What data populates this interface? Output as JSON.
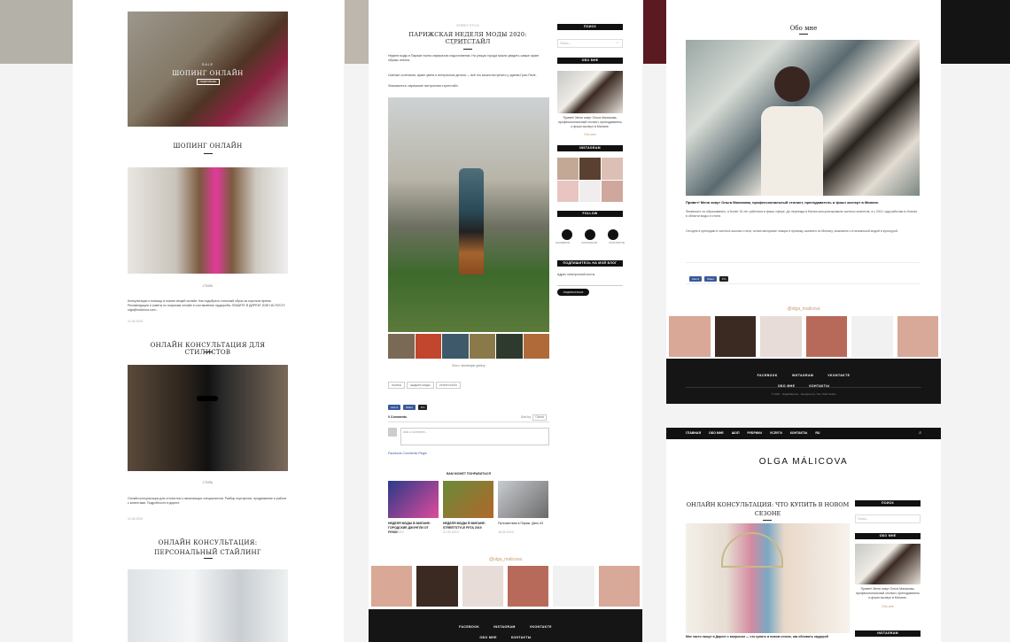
{
  "left": {
    "hero_banner": "SALE",
    "hero_title": "ШОПИНГ ОНЛАЙН",
    "hero_button": "ПОДРОБНЕЕ",
    "post1_title": "ШОПИНГ ОНЛАЙН",
    "post1_tag": "СТИЛЬ",
    "post1_excerpt": "Консультации и помощь в поиске вещей онлайн. Как подобрать стильный образ за короткое время. Рекомендации и советы по покупкам онлайн и составлению гардероба. ПИШИТЕ В ДИРЕКТ ИЛИ НА ПОЧТУ olga@malicova.com...",
    "post1_date": "11.09.2020",
    "post2_title": "ОНЛАЙН КОНСУЛЬТАЦИЯ ДЛЯ СТИЛИСТОВ",
    "post2_tag": "СТИЛЬ",
    "post2_excerpt": "Онлайн консультация для стилистов и начинающих специалистов. Разбор портфолио, продвижение и работа с клиентами. Подробности в директ.",
    "post2_date": "11.09.2020",
    "post3_title": "ОНЛАЙН КОНСУЛЬТАЦИЯ: ПЕРСОНАЛЬНЫЙ СТАЙЛИНГ"
  },
  "middle": {
    "category": "STREET STYLE",
    "title": "ПАРИЖСКАЯ НЕДЕЛЯ МОДЫ 2020: СТРИТСТАЙЛ",
    "meta": "Olga Malicova · 11.03.2020",
    "para1": "Неделя моды в Париже полна сюрпризов и вдохновения. На улицах города можно увидеть самые яркие образы сезона.",
    "para2": "Смелые сочетания, яркие цвета и интересные детали — всё это можно встретить у здания Гран-Пале.",
    "para3": "Знакомьтесь: парижские настроения стритстайл",
    "photo_credit": "Фото: streetstyle gallery",
    "tags": [
      "ПАРИЖ",
      "НЕДЕЛЯ МОДЫ",
      "СТРИТСТАЙЛ"
    ],
    "share_buttons": [
      "Like 0",
      "Share"
    ],
    "share_more": "Pin",
    "comments_count": "0 Comments",
    "sort_label": "Sort by",
    "sort_value": "Oldest",
    "comment_placeholder": "Add a comment...",
    "fb_plugin": "Facebook Comments Plugin",
    "related_heading": "ВАМ МОЖЕТ ПОНРАВИТЬСЯ",
    "related": [
      {
        "title": "НЕДЕЛЯ МОДЫ В МИЛАНЕ: ГОРОДСКИЕ ДЖУНГЛИ ОТ FENDI",
        "date": "22.09.2019"
      },
      {
        "title": "НЕДЕЛЯ МОДЫ В МИЛАНЕ: STREETSTYLE FETA 2019",
        "date": "21.09.2019"
      },
      {
        "title": "Путешествие в Париж. День #3",
        "date": "18.09.2019"
      }
    ],
    "insta_label": "@olga_malicova",
    "footer_links": [
      "FACEBOOK",
      "INSTAGRAM",
      "VKONTAKTE"
    ],
    "footer_links2": [
      "ОБО МНЕ",
      "КОНТАКТЫ"
    ],
    "sidebar": {
      "search_title": "ПОИСК",
      "search_placeholder": "Поиск...",
      "about_title": "ОБО МНЕ",
      "about_text": "Привет! Меня зовут Ольга Маликова, профессиональный стилист, преподаватель и фэшн эксперт в Милане.",
      "about_link": "Обо мне",
      "insta_title": "INSTAGRAM",
      "follow_title": "FOLLOW",
      "social": [
        "FACEBOOK",
        "INSTAGRAM",
        "VKONTAKTE"
      ],
      "subscribe_title": "ПОДПИШИТЕСЬ НА МОЙ БЛОГ",
      "email_label": "Адрес электронной почты",
      "subscribe_button": "ПОДПИСАТЬСЯ"
    }
  },
  "right_top": {
    "title": "Обо мне",
    "bold_intro": "Привет! Меня зовут Ольга Маликова, профессиональный стилист, преподаватель и фэшн эксперт в Милане.",
    "para1": "Финансист по образованию, я более 15 лет работала в фэшн сфере. До переезда в Милан консультировала частных клиентов, а с 2011 года работаю в Италии в области моды и стиля.",
    "para2": "Сегодня я преподаю в частных школах стиля, читаю авторские лекции и провожу шопинги по Милану, знакомлю с итальянской модой и культурой.",
    "share_buttons": [
      "Like 0",
      "Share"
    ],
    "share_more": "Pin",
    "insta_label": "@olga_malicova",
    "footer_links": [
      "FACEBOOK",
      "INSTAGRAM",
      "VKONTAKTE"
    ],
    "footer_links2": [
      "ОБО МНЕ",
      "КОНТАКТЫ"
    ],
    "copyright": "© 2020 · OlgaMalicova · Designed by Your Web Studio"
  },
  "right_bottom": {
    "nav": [
      "ГЛАВНАЯ",
      "ОБО МНЕ",
      "ШОП",
      "РУБРИКИ",
      "УСЛУГИ",
      "КОНТАКТЫ",
      "RU"
    ],
    "logo": "OLGA MÁLICOVA",
    "title": "ОНЛАЙН КОНСУЛЬТАЦИЯ: ЧТО КУПИТЬ В НОВОМ СЕЗОНЕ",
    "excerpt": "Мне часто пишут в Директ с вопросом — что купить в новом сезоне, как обновить гардероб",
    "sidebar": {
      "search_title": "ПОИСК",
      "search_placeholder": "Поиск...",
      "about_title": "ОБО МНЕ",
      "about_text": "Привет! Меня зовут Ольга Маликова, профессиональный стилист, преподаватель и фэшн эксперт в Милане.",
      "about_link": "Обо мне",
      "insta_title": "INSTAGRAM"
    }
  },
  "colors": {
    "accent": "#c49a6c",
    "dark": "#111111",
    "facebook": "#3b5998"
  }
}
